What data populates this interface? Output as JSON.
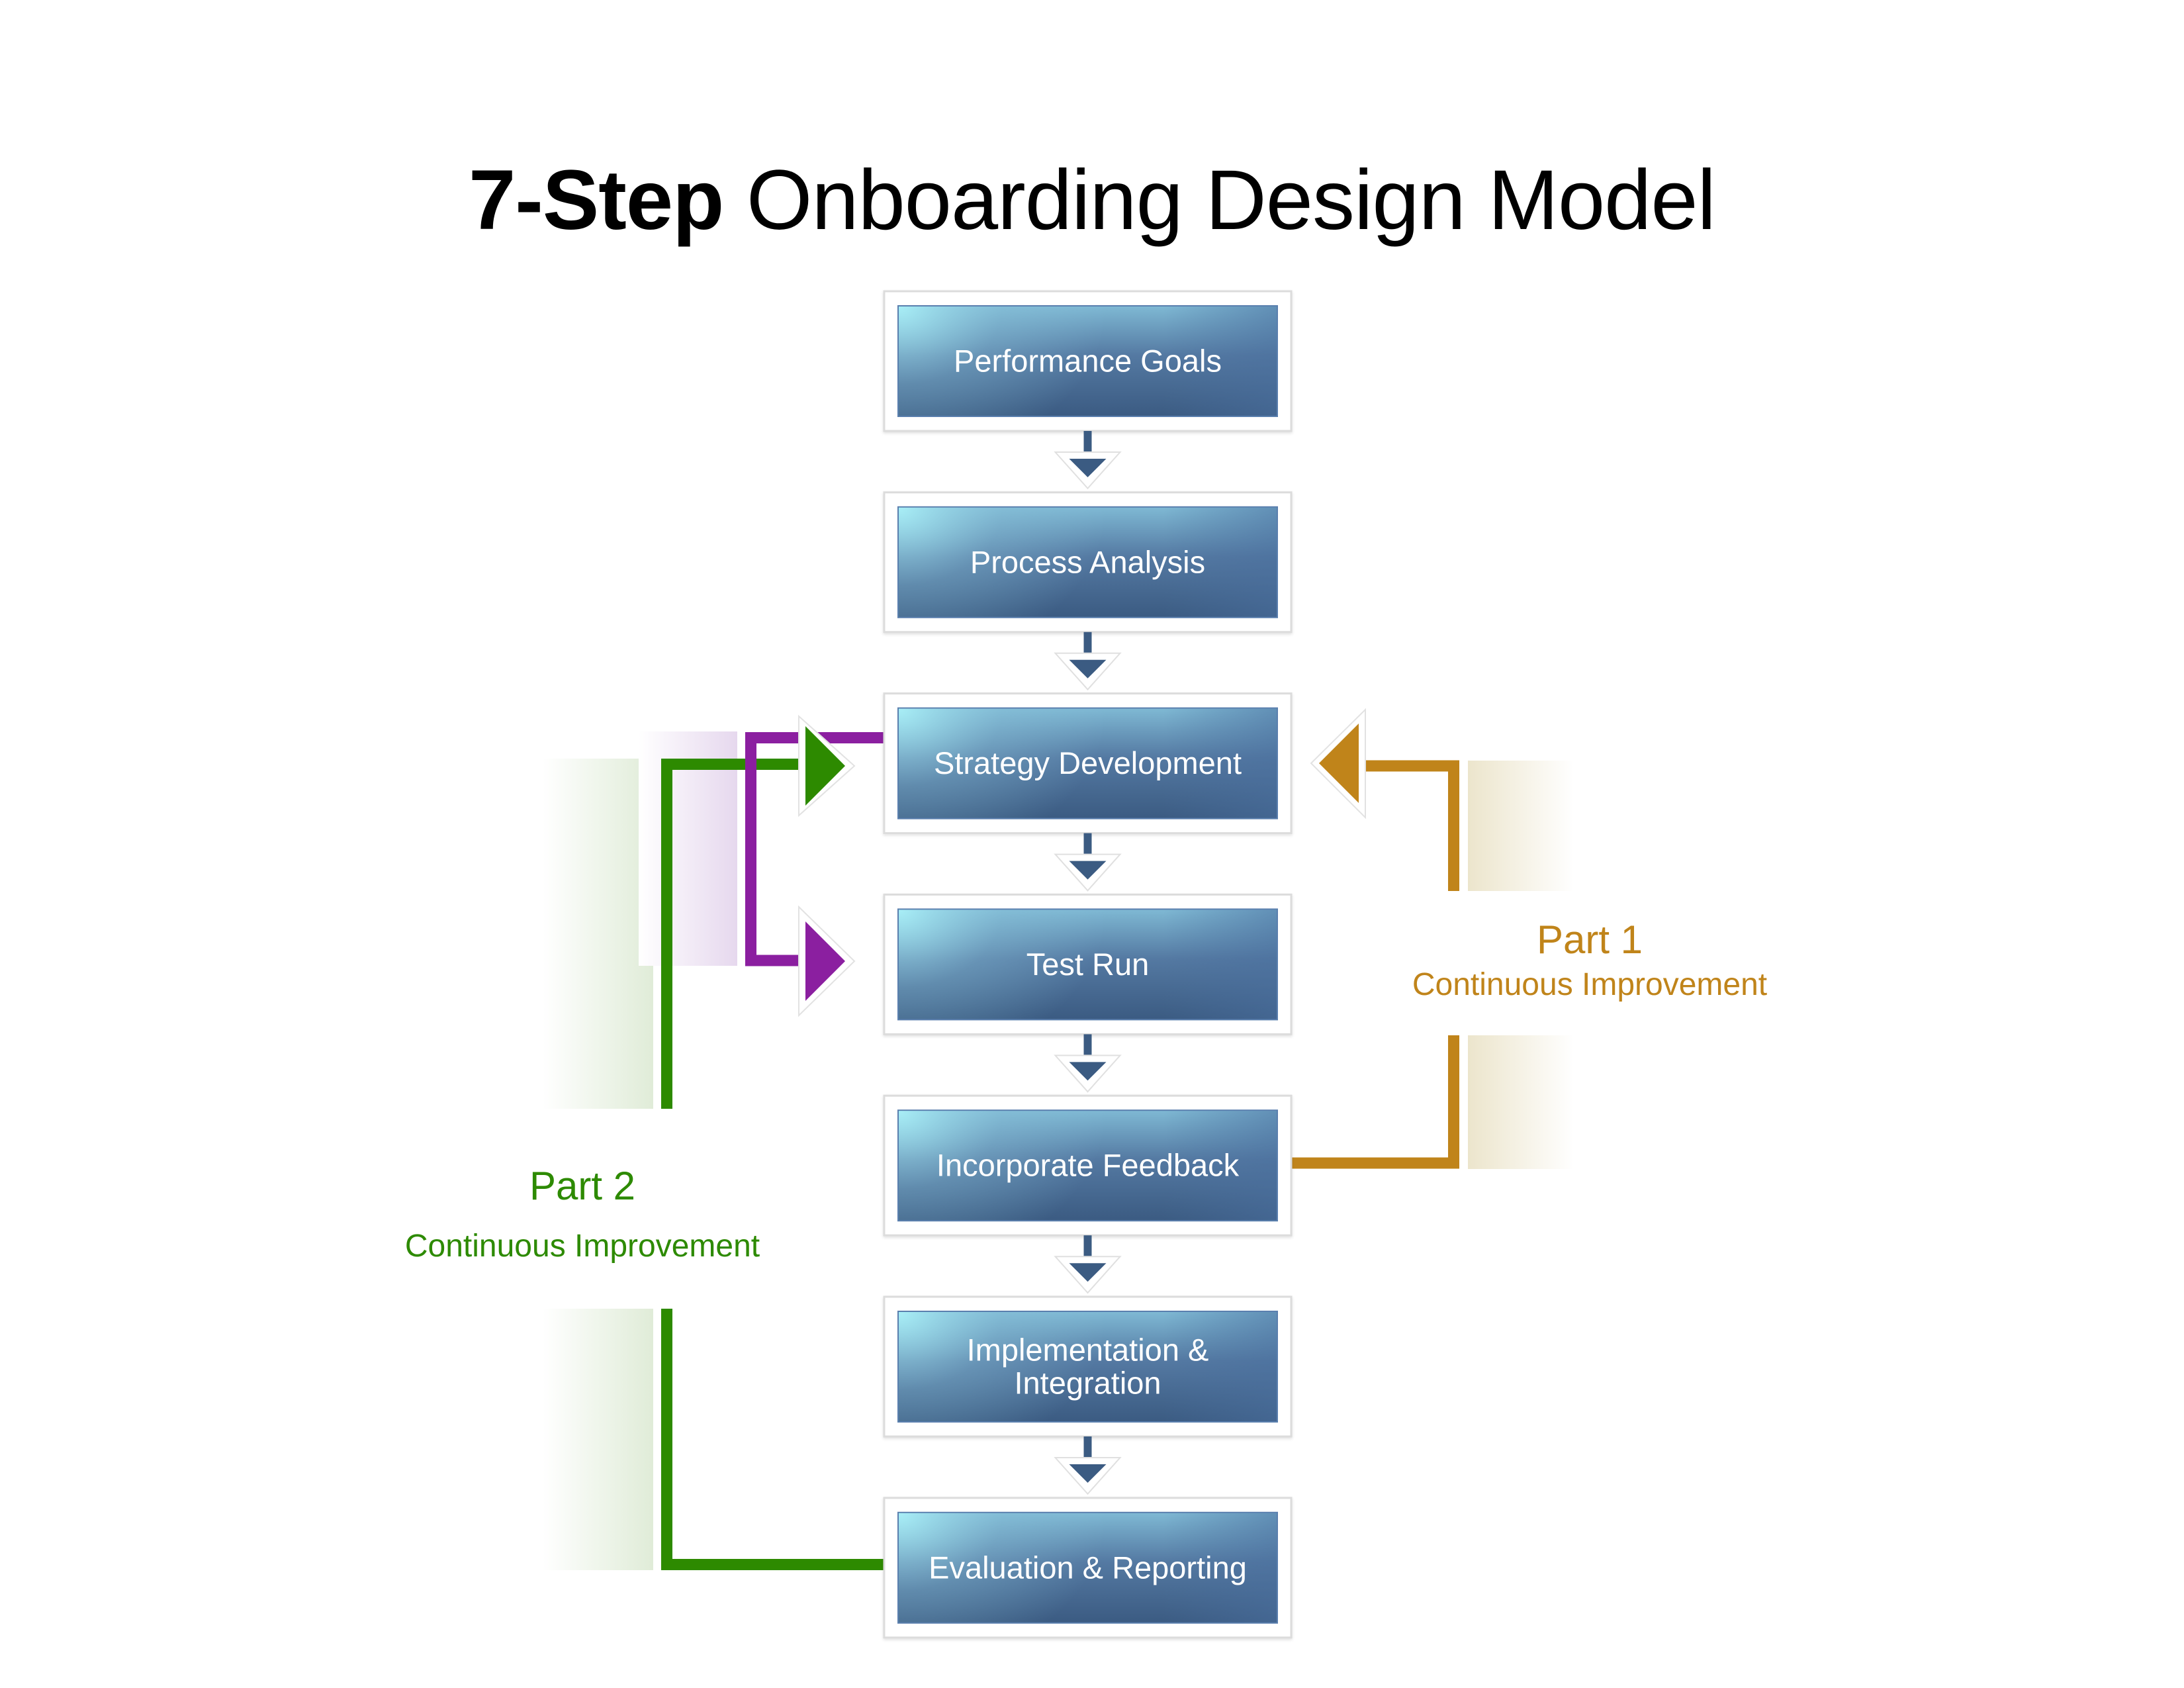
{
  "title": {
    "bold": "7-Step",
    "light": "Onboarding Design Model"
  },
  "steps": [
    {
      "label_lines": [
        "Performance Goals"
      ]
    },
    {
      "label_lines": [
        "Process Analysis"
      ]
    },
    {
      "label_lines": [
        "Strategy Development"
      ]
    },
    {
      "label_lines": [
        "Test Run"
      ]
    },
    {
      "label_lines": [
        "Incorporate Feedback"
      ]
    },
    {
      "label_lines": [
        "Implementation &",
        "Integration"
      ]
    },
    {
      "label_lines": [
        "Evaluation & Reporting"
      ]
    }
  ],
  "loops": {
    "part1": {
      "title": "Part 1",
      "subtitle": "Continuous Improvement",
      "from_step": "Incorporate Feedback",
      "to_step": "Strategy Development",
      "color": "#c0841a",
      "shade_color": "#ece5cc"
    },
    "part2": {
      "title": "Part 2",
      "subtitle": "Continuous Improvement",
      "from_step": "Evaluation & Reporting",
      "to_step": "Strategy Development",
      "color": "#2d8a00",
      "shade_color": "#e0ecd8"
    },
    "inner_loop": {
      "from_step": "Strategy Development",
      "to_step": "Test Run",
      "color": "#8b1fa0",
      "shade_color": "#e6d8ee"
    }
  },
  "colors": {
    "box_top_left": "#a3e8f2",
    "box_mid": "#5479a2",
    "box_bottom": "#3b5b82",
    "box_border": "#5a7fae",
    "connector": "#3b5b82",
    "frame_border": "#dcdcdc"
  }
}
